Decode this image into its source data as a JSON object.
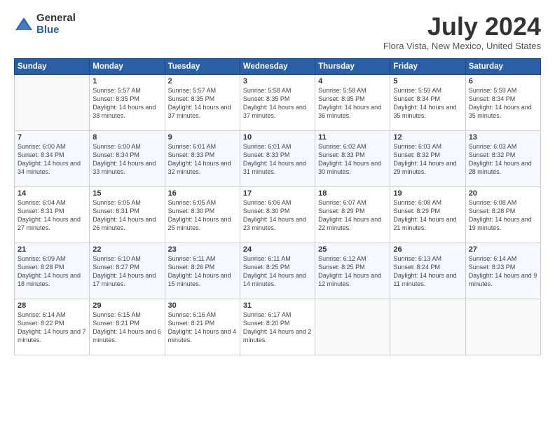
{
  "logo": {
    "general": "General",
    "blue": "Blue"
  },
  "title": "July 2024",
  "location": "Flora Vista, New Mexico, United States",
  "weekdays": [
    "Sunday",
    "Monday",
    "Tuesday",
    "Wednesday",
    "Thursday",
    "Friday",
    "Saturday"
  ],
  "weeks": [
    [
      {
        "day": "",
        "info": ""
      },
      {
        "day": "1",
        "info": "Sunrise: 5:57 AM\nSunset: 8:35 PM\nDaylight: 14 hours\nand 38 minutes."
      },
      {
        "day": "2",
        "info": "Sunrise: 5:57 AM\nSunset: 8:35 PM\nDaylight: 14 hours\nand 37 minutes."
      },
      {
        "day": "3",
        "info": "Sunrise: 5:58 AM\nSunset: 8:35 PM\nDaylight: 14 hours\nand 37 minutes."
      },
      {
        "day": "4",
        "info": "Sunrise: 5:58 AM\nSunset: 8:35 PM\nDaylight: 14 hours\nand 36 minutes."
      },
      {
        "day": "5",
        "info": "Sunrise: 5:59 AM\nSunset: 8:34 PM\nDaylight: 14 hours\nand 35 minutes."
      },
      {
        "day": "6",
        "info": "Sunrise: 5:59 AM\nSunset: 8:34 PM\nDaylight: 14 hours\nand 35 minutes."
      }
    ],
    [
      {
        "day": "7",
        "info": "Sunrise: 6:00 AM\nSunset: 8:34 PM\nDaylight: 14 hours\nand 34 minutes."
      },
      {
        "day": "8",
        "info": "Sunrise: 6:00 AM\nSunset: 8:34 PM\nDaylight: 14 hours\nand 33 minutes."
      },
      {
        "day": "9",
        "info": "Sunrise: 6:01 AM\nSunset: 8:33 PM\nDaylight: 14 hours\nand 32 minutes."
      },
      {
        "day": "10",
        "info": "Sunrise: 6:01 AM\nSunset: 8:33 PM\nDaylight: 14 hours\nand 31 minutes."
      },
      {
        "day": "11",
        "info": "Sunrise: 6:02 AM\nSunset: 8:33 PM\nDaylight: 14 hours\nand 30 minutes."
      },
      {
        "day": "12",
        "info": "Sunrise: 6:03 AM\nSunset: 8:32 PM\nDaylight: 14 hours\nand 29 minutes."
      },
      {
        "day": "13",
        "info": "Sunrise: 6:03 AM\nSunset: 8:32 PM\nDaylight: 14 hours\nand 28 minutes."
      }
    ],
    [
      {
        "day": "14",
        "info": "Sunrise: 6:04 AM\nSunset: 8:31 PM\nDaylight: 14 hours\nand 27 minutes."
      },
      {
        "day": "15",
        "info": "Sunrise: 6:05 AM\nSunset: 8:31 PM\nDaylight: 14 hours\nand 26 minutes."
      },
      {
        "day": "16",
        "info": "Sunrise: 6:05 AM\nSunset: 8:30 PM\nDaylight: 14 hours\nand 25 minutes."
      },
      {
        "day": "17",
        "info": "Sunrise: 6:06 AM\nSunset: 8:30 PM\nDaylight: 14 hours\nand 23 minutes."
      },
      {
        "day": "18",
        "info": "Sunrise: 6:07 AM\nSunset: 8:29 PM\nDaylight: 14 hours\nand 22 minutes."
      },
      {
        "day": "19",
        "info": "Sunrise: 6:08 AM\nSunset: 8:29 PM\nDaylight: 14 hours\nand 21 minutes."
      },
      {
        "day": "20",
        "info": "Sunrise: 6:08 AM\nSunset: 8:28 PM\nDaylight: 14 hours\nand 19 minutes."
      }
    ],
    [
      {
        "day": "21",
        "info": "Sunrise: 6:09 AM\nSunset: 8:28 PM\nDaylight: 14 hours\nand 18 minutes."
      },
      {
        "day": "22",
        "info": "Sunrise: 6:10 AM\nSunset: 8:27 PM\nDaylight: 14 hours\nand 17 minutes."
      },
      {
        "day": "23",
        "info": "Sunrise: 6:11 AM\nSunset: 8:26 PM\nDaylight: 14 hours\nand 15 minutes."
      },
      {
        "day": "24",
        "info": "Sunrise: 6:11 AM\nSunset: 8:25 PM\nDaylight: 14 hours\nand 14 minutes."
      },
      {
        "day": "25",
        "info": "Sunrise: 6:12 AM\nSunset: 8:25 PM\nDaylight: 14 hours\nand 12 minutes."
      },
      {
        "day": "26",
        "info": "Sunrise: 6:13 AM\nSunset: 8:24 PM\nDaylight: 14 hours\nand 11 minutes."
      },
      {
        "day": "27",
        "info": "Sunrise: 6:14 AM\nSunset: 8:23 PM\nDaylight: 14 hours\nand 9 minutes."
      }
    ],
    [
      {
        "day": "28",
        "info": "Sunrise: 6:14 AM\nSunset: 8:22 PM\nDaylight: 14 hours\nand 7 minutes."
      },
      {
        "day": "29",
        "info": "Sunrise: 6:15 AM\nSunset: 8:21 PM\nDaylight: 14 hours\nand 6 minutes."
      },
      {
        "day": "30",
        "info": "Sunrise: 6:16 AM\nSunset: 8:21 PM\nDaylight: 14 hours\nand 4 minutes."
      },
      {
        "day": "31",
        "info": "Sunrise: 6:17 AM\nSunset: 8:20 PM\nDaylight: 14 hours\nand 2 minutes."
      },
      {
        "day": "",
        "info": ""
      },
      {
        "day": "",
        "info": ""
      },
      {
        "day": "",
        "info": ""
      }
    ]
  ]
}
